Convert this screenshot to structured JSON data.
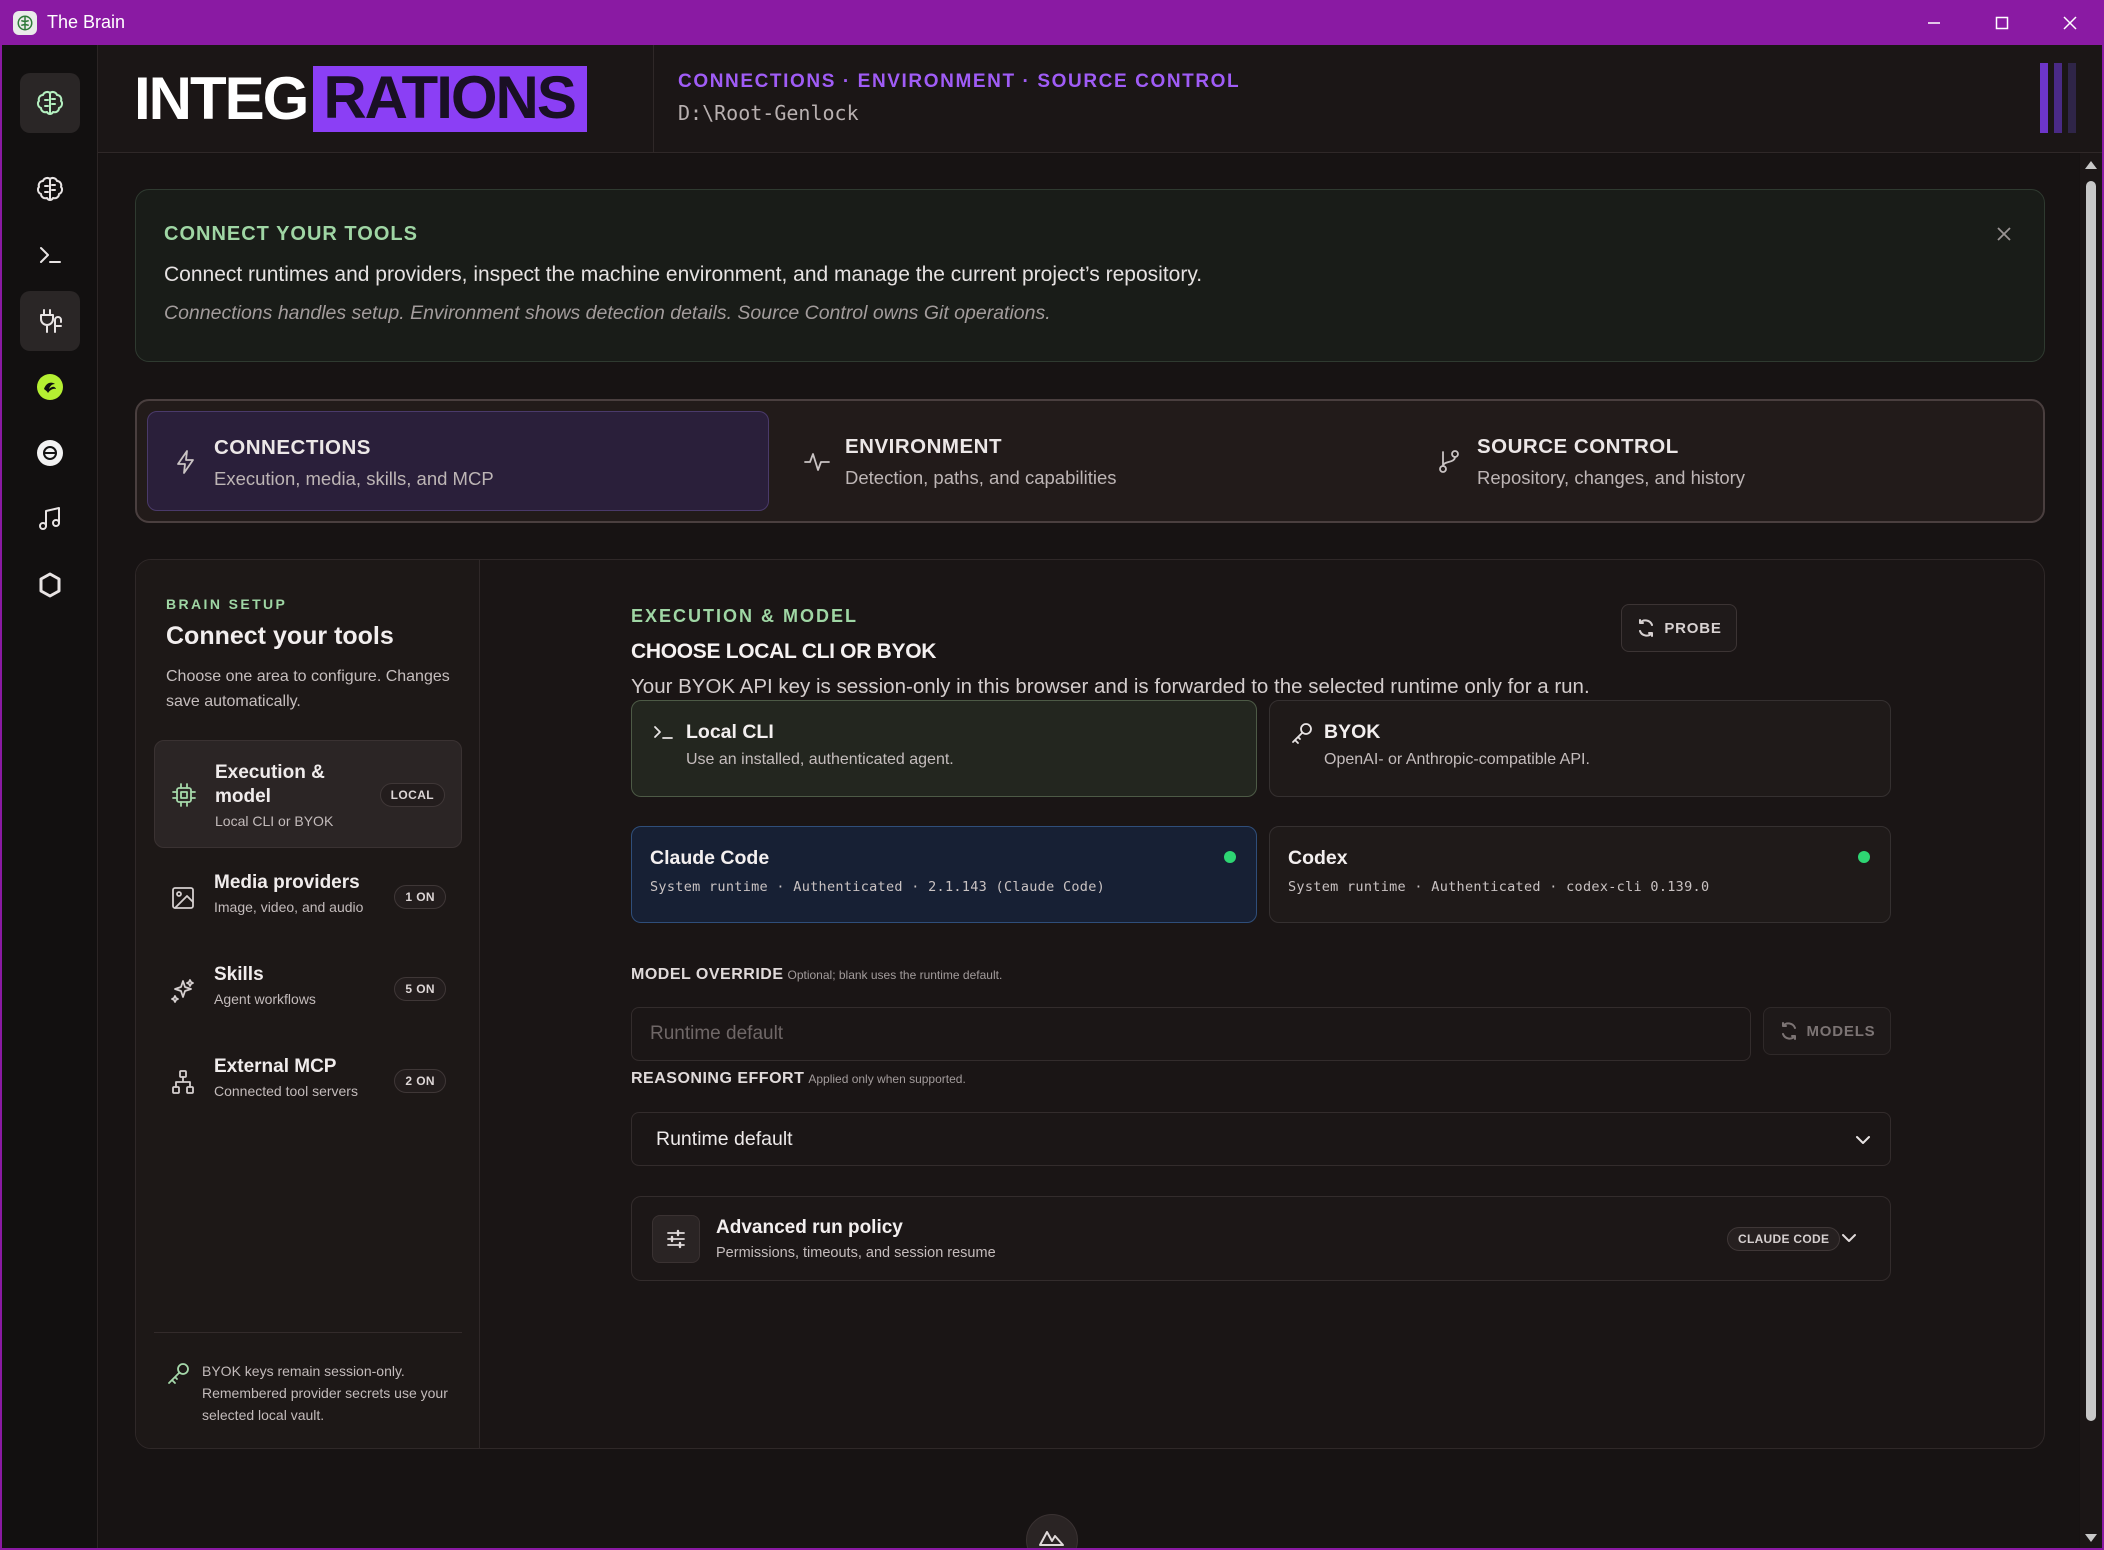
{
  "window": {
    "title": "The Brain",
    "icons": {
      "app": "brain-icon",
      "minimize": "minimize-icon",
      "maximize": "maximize-icon",
      "close": "close-icon"
    }
  },
  "rail": {
    "items": [
      {
        "name": "brand",
        "icon": "brain-icon"
      },
      {
        "name": "brain",
        "icon": "brain-icon"
      },
      {
        "name": "terminal",
        "icon": "terminal-icon"
      },
      {
        "name": "integrations",
        "icon": "plug-icon"
      },
      {
        "name": "fal",
        "icon": "fal-logo-icon"
      },
      {
        "name": "openai",
        "icon": "openai-logo-icon"
      },
      {
        "name": "music",
        "icon": "music-note-icon"
      },
      {
        "name": "settings",
        "icon": "hexagon-icon"
      }
    ]
  },
  "header": {
    "title_part1": "INTEG",
    "title_part2": "RATIONS",
    "crumbs": "CONNECTIONS · ENVIRONMENT · SOURCE CONTROL",
    "path": "D:\\Root-Genlock",
    "bar_colors": [
      "#6d35c9",
      "#4a2a86",
      "#2f2548"
    ]
  },
  "banner": {
    "title": "CONNECT YOUR TOOLS",
    "text": "Connect runtimes and providers, inspect the machine environment, and manage the current project’s repository.",
    "note": "Connections handles setup. Environment shows detection details. Source Control owns Git operations."
  },
  "tabs": [
    {
      "title": "CONNECTIONS",
      "subtitle": "Execution, media, skills, and MCP",
      "icon": "lightning-icon",
      "active": true
    },
    {
      "title": "ENVIRONMENT",
      "subtitle": "Detection, paths, and capabilities",
      "icon": "pulse-icon",
      "active": false
    },
    {
      "title": "SOURCE CONTROL",
      "subtitle": "Repository, changes, and history",
      "icon": "git-branch-icon",
      "active": false
    }
  ],
  "sidebar": {
    "eyebrow": "BRAIN SETUP",
    "title": "Connect your tools",
    "description": "Choose one area to configure. Changes save automatically.",
    "items": [
      {
        "title": "Execution & model",
        "subtitle": "Local CLI or BYOK",
        "badge": "LOCAL",
        "icon": "cpu-icon",
        "active": true
      },
      {
        "title": "Media providers",
        "subtitle": "Image, video, and audio",
        "badge": "1 ON",
        "icon": "image-icon",
        "active": false
      },
      {
        "title": "Skills",
        "subtitle": "Agent workflows",
        "badge": "5 ON",
        "icon": "sparkles-icon",
        "active": false
      },
      {
        "title": "External MCP",
        "subtitle": "Connected tool servers",
        "badge": "2 ON",
        "icon": "network-icon",
        "active": false
      }
    ],
    "footer": "BYOK keys remain session-only. Remembered provider secrets use your selected local vault."
  },
  "main": {
    "eyebrow": "EXECUTION & MODEL",
    "title": "CHOOSE LOCAL CLI OR BYOK",
    "description": "Your BYOK API key is session-only in this browser and is forwarded to the selected runtime only for a run.",
    "probe_label": "PROBE",
    "modes": [
      {
        "title": "Local CLI",
        "subtitle": "Use an installed, authenticated agent.",
        "icon": "terminal-icon",
        "selected": true
      },
      {
        "title": "BYOK",
        "subtitle": "OpenAI- or Anthropic-compatible API.",
        "icon": "key-icon",
        "selected": false
      }
    ],
    "runtimes": [
      {
        "title": "Claude Code",
        "detail": "System runtime · Authenticated · 2.1.143 (Claude Code)",
        "selected": true,
        "status_color": "#2ed573"
      },
      {
        "title": "Codex",
        "detail": "System runtime · Authenticated · codex-cli 0.139.0",
        "selected": false,
        "status_color": "#2ed573"
      }
    ],
    "model_override": {
      "label": "MODEL OVERRIDE",
      "hint": "Optional; blank uses the runtime default.",
      "value": "",
      "placeholder": "Runtime default",
      "models_label": "MODELS"
    },
    "reasoning_effort": {
      "label": "REASONING EFFORT",
      "hint": "Applied only when supported.",
      "value": "Runtime default"
    },
    "advanced": {
      "title": "Advanced run policy",
      "subtitle": "Permissions, timeouts, and session resume",
      "badge": "CLAUDE CODE"
    }
  },
  "colors": {
    "accent_purple": "#8b3ff5",
    "titlebar": "#8a1aa3",
    "accent_green": "#9fd6a4",
    "status_green": "#2ed573"
  }
}
